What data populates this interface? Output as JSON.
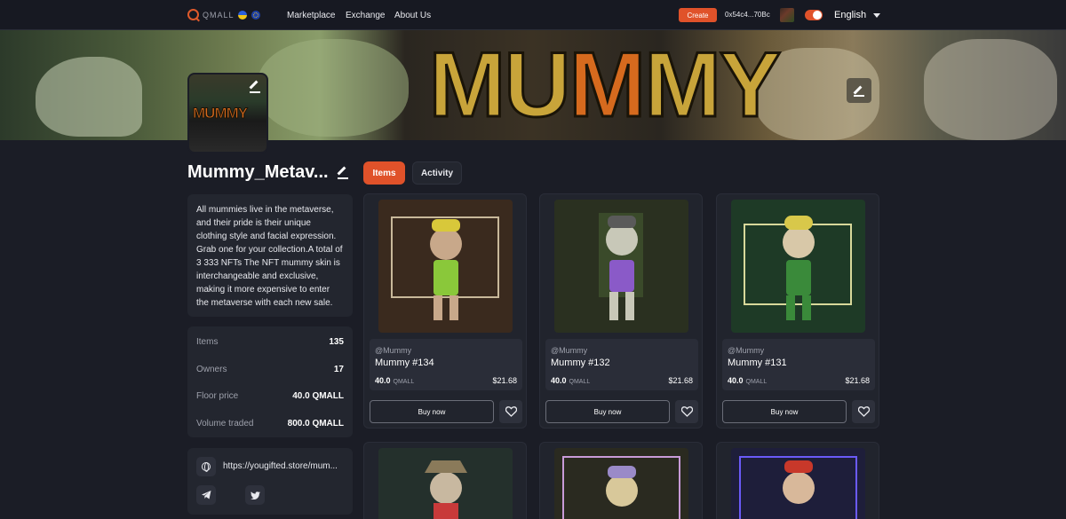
{
  "nav": {
    "logo_text": "QMALL",
    "links": [
      "Marketplace",
      "Exchange",
      "About Us"
    ],
    "create_label": "Create",
    "wallet": "0x54c4...70Bc",
    "language": "English"
  },
  "banner": {
    "title_left": "MU",
    "title_mid": "M",
    "title_right": "MY"
  },
  "avatar": {
    "text": "MUMMY"
  },
  "collection": {
    "name": "Mummy_Metav...",
    "description": "All mummies live in the metaverse, and their pride is their unique clothing style and facial expression. Grab one for your collection.A total of 3 333 NFTs The NFT mummy skin is interchangeable and exclusive, making it more expensive to enter the metaverse with each new sale.",
    "stats": [
      {
        "label": "Items",
        "value": "135"
      },
      {
        "label": "Owners",
        "value": "17"
      },
      {
        "label": "Floor price",
        "value": "40.0 QMALL"
      },
      {
        "label": "Volume traded",
        "value": "800.0 QMALL"
      }
    ],
    "website": "https://yougifted.store/mum..."
  },
  "tabs": [
    "Items",
    "Activity"
  ],
  "cards": [
    {
      "creator": "@Mummy",
      "name": "Mummy #134",
      "price": "40.0",
      "currency": "QMALL",
      "usd": "$21.68",
      "buy": "Buy now",
      "bg": "#3a2a1e",
      "accent": "#c8b83a"
    },
    {
      "creator": "@Mummy",
      "name": "Mummy #132",
      "price": "40.0",
      "currency": "QMALL",
      "usd": "$21.68",
      "buy": "Buy now",
      "bg": "#2a3020",
      "accent": "#8a5ac8"
    },
    {
      "creator": "@Mummy",
      "name": "Mummy #131",
      "price": "40.0",
      "currency": "QMALL",
      "usd": "$21.68",
      "buy": "Buy now",
      "bg": "#1e3a26",
      "accent": "#d8c84a"
    },
    {
      "bg": "#24302c",
      "accent": "#8a7a5a"
    },
    {
      "bg": "#2a2a20",
      "accent": "#9a8ac8"
    },
    {
      "bg": "#1e1e3a",
      "accent": "#c8382a"
    }
  ],
  "colors": {
    "accent": "#e0522a",
    "background": "#1b1d26",
    "panel": "#23262f"
  }
}
